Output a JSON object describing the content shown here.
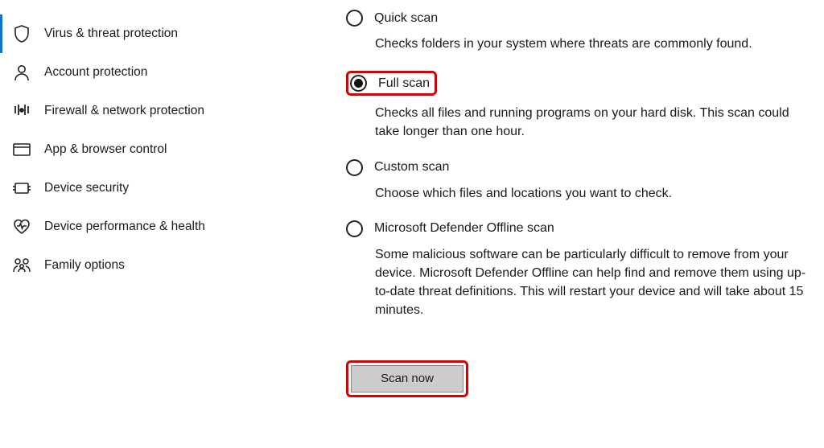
{
  "sidebar": {
    "items": [
      {
        "label": "Virus & threat protection"
      },
      {
        "label": "Account protection"
      },
      {
        "label": "Firewall & network protection"
      },
      {
        "label": "App & browser control"
      },
      {
        "label": "Device security"
      },
      {
        "label": "Device performance & health"
      },
      {
        "label": "Family options"
      }
    ]
  },
  "scan_options": {
    "quick": {
      "title": "Quick scan",
      "desc": "Checks folders in your system where threats are commonly found."
    },
    "full": {
      "title": "Full scan",
      "desc": "Checks all files and running programs on your hard disk. This scan could take longer than one hour."
    },
    "custom": {
      "title": "Custom scan",
      "desc": "Choose which files and locations you want to check."
    },
    "offline": {
      "title": "Microsoft Defender Offline scan",
      "desc": "Some malicious software can be particularly difficult to remove from your device. Microsoft Defender Offline can help find and remove them using up-to-date threat definitions. This will restart your device and will take about 15 minutes."
    }
  },
  "button": {
    "scan_now": "Scan now"
  }
}
